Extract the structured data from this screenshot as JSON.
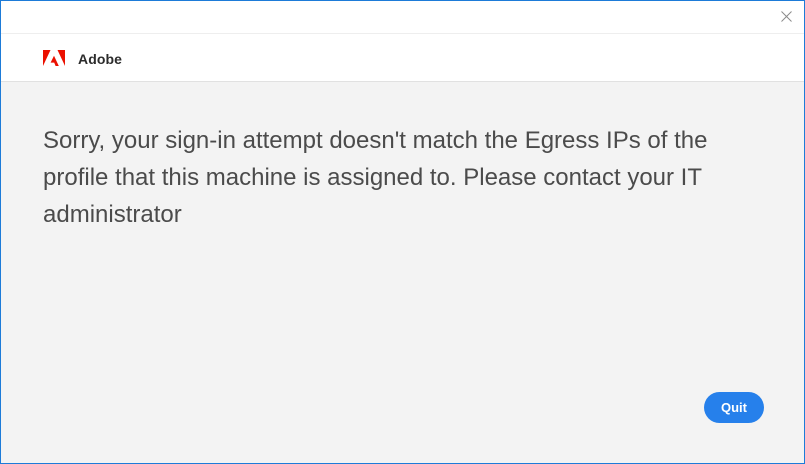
{
  "window": {
    "close_icon": "close-icon"
  },
  "header": {
    "logo_icon": "adobe-logo-icon",
    "brand_name": "Adobe"
  },
  "dialog": {
    "message": "Sorry, your sign-in attempt doesn't match the Egress IPs of the profile that this machine is assigned to. Please contact your IT administrator",
    "quit_label": "Quit"
  },
  "colors": {
    "accent": "#2680eb",
    "brand_red": "#eb1000",
    "window_border": "#1d7bd8",
    "background": "#f3f3f3"
  }
}
